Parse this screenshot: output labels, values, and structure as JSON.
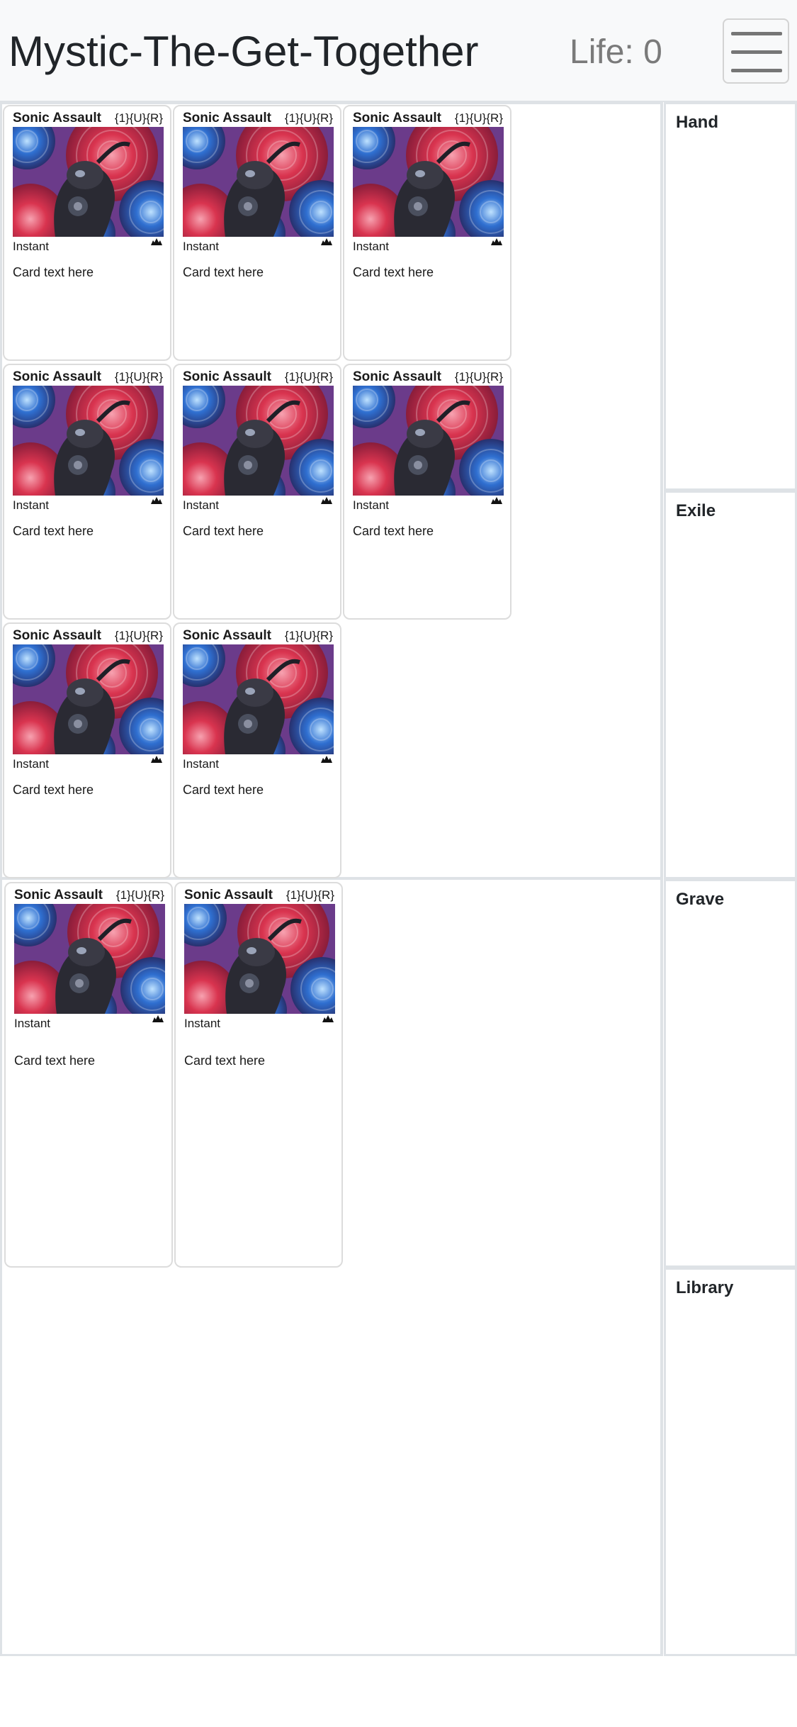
{
  "header": {
    "app_title": "Mystic-The-Get-Together",
    "life_text": "Life: 0",
    "menu_icon": "hamburger-menu-icon"
  },
  "zones": {
    "hand": "Hand",
    "exile": "Exile",
    "grave": "Grave",
    "library": "Library"
  },
  "card": {
    "name": "Sonic Assault",
    "cost": "{1}{U}{R}",
    "type": "Instant",
    "text": "Card text here",
    "set_icon": "set-symbol-icon"
  },
  "battlefield": {
    "cards": [
      {
        "name": "Sonic Assault",
        "cost": "{1}{U}{R}",
        "type": "Instant",
        "text": "Card text here"
      },
      {
        "name": "Sonic Assault",
        "cost": "{1}{U}{R}",
        "type": "Instant",
        "text": "Card text here"
      },
      {
        "name": "Sonic Assault",
        "cost": "{1}{U}{R}",
        "type": "Instant",
        "text": "Card text here"
      },
      {
        "name": "Sonic Assault",
        "cost": "{1}{U}{R}",
        "type": "Instant",
        "text": "Card text here"
      },
      {
        "name": "Sonic Assault",
        "cost": "{1}{U}{R}",
        "type": "Instant",
        "text": "Card text here"
      },
      {
        "name": "Sonic Assault",
        "cost": "{1}{U}{R}",
        "type": "Instant",
        "text": "Card text here"
      },
      {
        "name": "Sonic Assault",
        "cost": "{1}{U}{R}",
        "type": "Instant",
        "text": "Card text here"
      },
      {
        "name": "Sonic Assault",
        "cost": "{1}{U}{R}",
        "type": "Instant",
        "text": "Card text here"
      }
    ]
  },
  "lands": {
    "cards": [
      {
        "name": "Sonic Assault",
        "cost": "{1}{U}{R}",
        "type": "Instant",
        "text": "Card text here"
      },
      {
        "name": "Sonic Assault",
        "cost": "{1}{U}{R}",
        "type": "Instant",
        "text": "Card text here"
      }
    ]
  },
  "colors": {
    "art_red": "#d9344f",
    "art_blue": "#2f6fd0",
    "border": "#dee2e6"
  }
}
